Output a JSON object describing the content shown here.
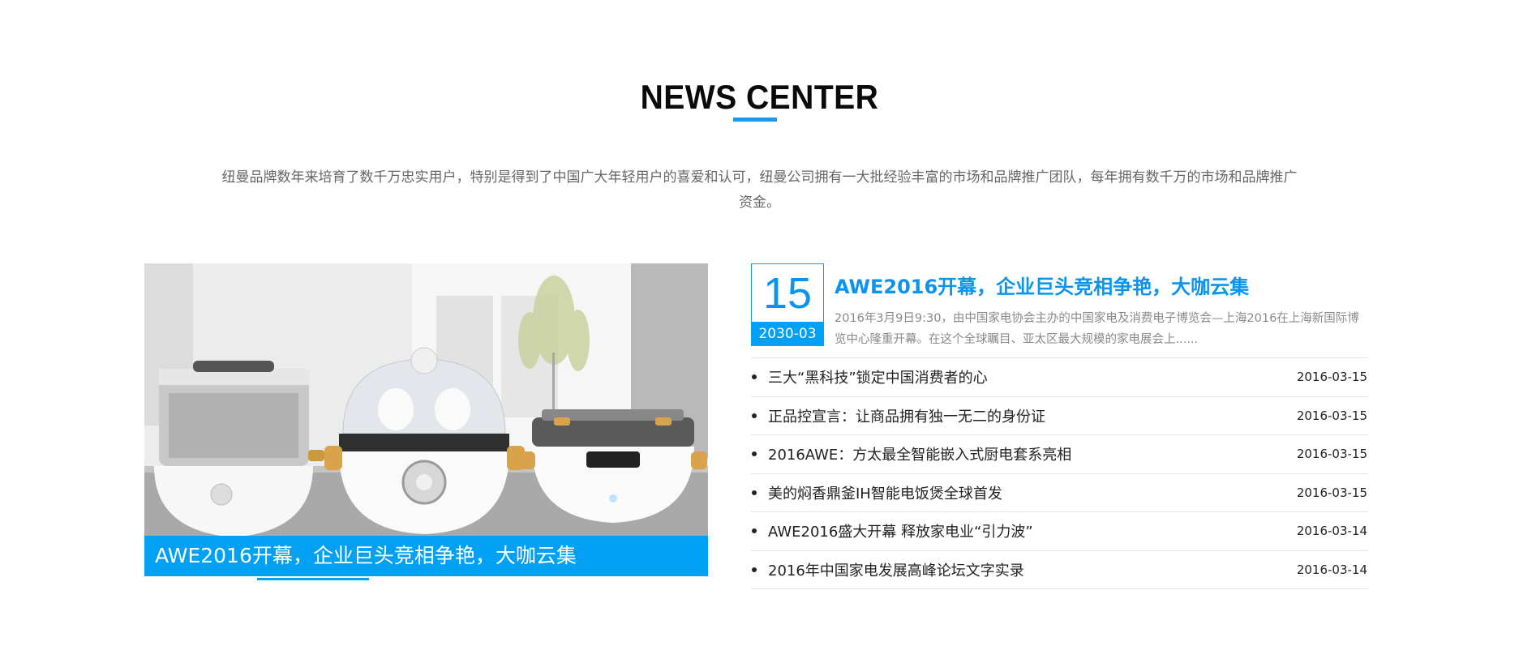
{
  "section": {
    "title": "NEWS CENTER",
    "intro": "纽曼品牌数年来培育了数千万忠实用户，特别是得到了中国广大年轻用户的喜爱和认可，纽曼公司拥有一大批经验丰富的市场和品牌推广团队，每年拥有数千万的市场和品牌推广资金。"
  },
  "feature": {
    "caption": "AWE2016开幕，企业巨头竞相争艳，大咖云集",
    "image": "kitchen-appliances-photo"
  },
  "highlight": {
    "day": "15",
    "year_month": "2030-03",
    "headline": "AWE2016开幕，企业巨头竞相争艳，大咖云集",
    "summary": "2016年3月9日9:30，由中国家电协会主办的中国家电及消费电子博览会—上海2016在上海新国际博览中心隆重开幕。在这个全球瞩目、亚太区最大规模的家电展会上......"
  },
  "news": [
    {
      "title": "三大“黑科技”锁定中国消费者的心",
      "date": "2016-03-15"
    },
    {
      "title": "正品控宣言：让商品拥有独一无二的身份证",
      "date": "2016-03-15"
    },
    {
      "title": "2016AWE：方太最全智能嵌入式厨电套系亮相",
      "date": "2016-03-15"
    },
    {
      "title": "美的焖香鼎釜IH智能电饭煲全球首发",
      "date": "2016-03-15"
    },
    {
      "title": "AWE2016盛大开幕 释放家电业“引力波”",
      "date": "2016-03-14"
    },
    {
      "title": "2016年中国家电发展高峰论坛文字实录",
      "date": "2016-03-14"
    }
  ],
  "colors": {
    "accent": "#00a0f5",
    "title": "#0a0a0a",
    "text": "#222222",
    "muted": "#8a8a8a"
  }
}
